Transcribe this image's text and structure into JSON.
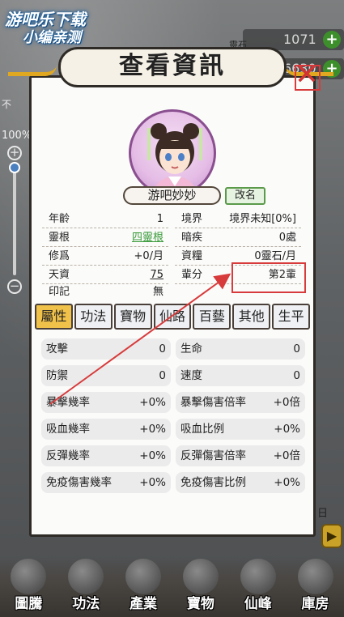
{
  "watermark": {
    "line1": "游吧乐下载",
    "line2": "小编亲测"
  },
  "resources": [
    {
      "icon": "spirit-stone-icon",
      "label": "靈石",
      "value": "1071"
    },
    {
      "icon": "ingot-icon",
      "value": "6630"
    }
  ],
  "left_controls": {
    "zoom_level": "100%",
    "side_label": "不"
  },
  "right_label": "日",
  "dialog": {
    "title": "查看資訊",
    "close": "✕",
    "name": "游吧妙妙",
    "rename": "改名",
    "info": {
      "age": {
        "label": "年齡",
        "value": "1"
      },
      "realm": {
        "label": "境界",
        "value": "境界未知[0%]"
      },
      "root": {
        "label": "靈根",
        "value": "四靈根"
      },
      "hidden_illness": {
        "label": "暗疾",
        "value": "0處"
      },
      "cultivation": {
        "label": "修爲",
        "value": "+0/月"
      },
      "resources": {
        "label": "資糧",
        "value": "0靈石/月"
      },
      "talent": {
        "label": "天資",
        "value": "75"
      },
      "generation": {
        "label": "輩分",
        "value": "第2輩"
      },
      "mark": {
        "label": "印記",
        "value": "無"
      }
    },
    "tabs": [
      "屬性",
      "功法",
      "寶物",
      "仙路",
      "百藝",
      "其他",
      "生平"
    ],
    "stats": [
      {
        "label": "攻擊",
        "value": "0"
      },
      {
        "label": "生命",
        "value": "0"
      },
      {
        "label": "防禦",
        "value": "0"
      },
      {
        "label": "速度",
        "value": "0"
      },
      {
        "label": "暴擊幾率",
        "value": "+0%"
      },
      {
        "label": "暴擊傷害倍率",
        "value": "+0倍"
      },
      {
        "label": "吸血幾率",
        "value": "+0%"
      },
      {
        "label": "吸血比例",
        "value": "+0%"
      },
      {
        "label": "反彈幾率",
        "value": "+0%"
      },
      {
        "label": "反彈傷害倍率",
        "value": "+0倍"
      },
      {
        "label": "免疫傷害幾率",
        "value": "+0%"
      },
      {
        "label": "免疫傷害比例",
        "value": "+0%"
      }
    ]
  },
  "bottom_nav": [
    {
      "label": "圖騰",
      "icon": "totem-icon"
    },
    {
      "label": "功法",
      "icon": "technique-icon"
    },
    {
      "label": "產業",
      "icon": "industry-icon"
    },
    {
      "label": "寶物",
      "icon": "treasure-icon"
    },
    {
      "label": "仙峰",
      "icon": "peak-icon"
    },
    {
      "label": "庫房",
      "icon": "storehouse-icon"
    }
  ],
  "colors": {
    "tab_active": "#f0c24a",
    "highlight": "#d83b3b",
    "arrow": "#d83b3b",
    "banner_deco": "#e0a820"
  }
}
